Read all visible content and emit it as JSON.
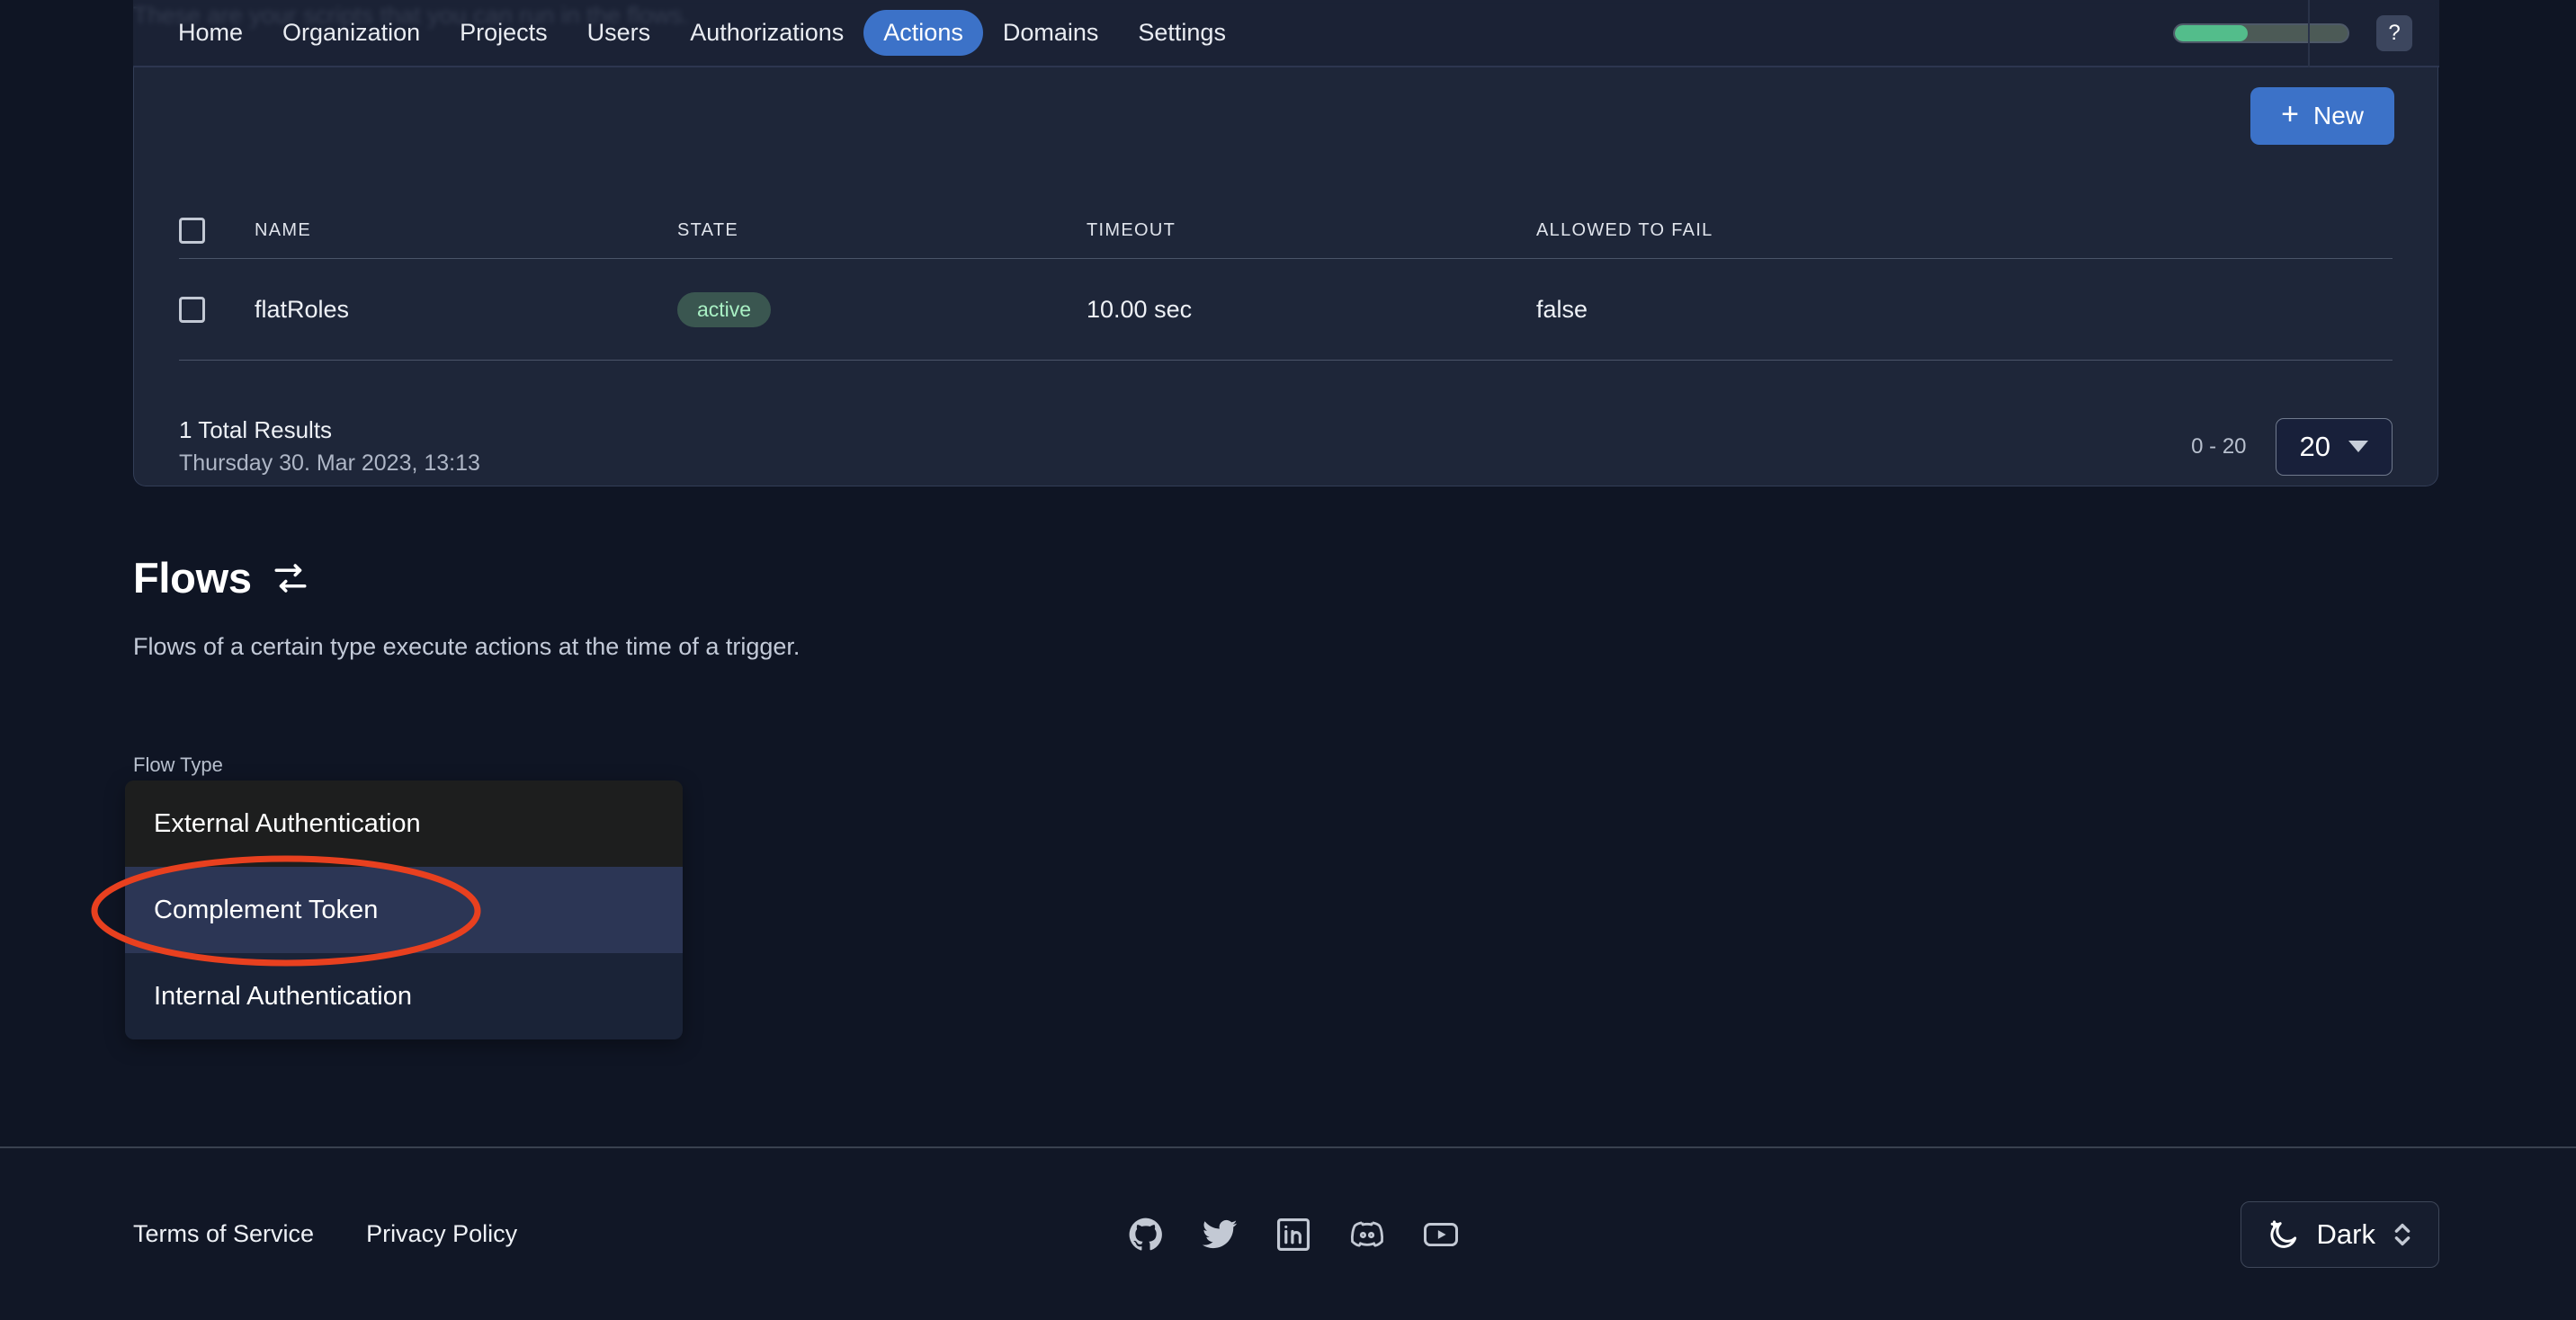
{
  "page": {
    "scrolled_under_text": "These are your scripts that you can run in the flows."
  },
  "nav": {
    "items": [
      {
        "label": "Home",
        "active": false
      },
      {
        "label": "Organization",
        "active": false
      },
      {
        "label": "Projects",
        "active": false
      },
      {
        "label": "Users",
        "active": false
      },
      {
        "label": "Authorizations",
        "active": false
      },
      {
        "label": "Actions",
        "active": true
      },
      {
        "label": "Domains",
        "active": false
      },
      {
        "label": "Settings",
        "active": false
      }
    ],
    "progress_percent": 42,
    "help_label": "?",
    "accent_color": "#3c72c8",
    "progress_color": "#53bd8b"
  },
  "actions_card": {
    "new_button_label": "New",
    "new_button_icon": "plus-icon",
    "table": {
      "columns": [
        "NAME",
        "STATE",
        "TIMEOUT",
        "ALLOWED TO FAIL"
      ],
      "rows": [
        {
          "name": "flatRoles",
          "state": "active",
          "timeout": "10.00 sec",
          "allowed_to_fail": "false"
        }
      ]
    },
    "footer": {
      "total_results": "1 Total Results",
      "timestamp": "Thursday 30. Mar 2023, 13:13",
      "range": "0 - 20",
      "page_size": "20"
    }
  },
  "flows": {
    "title": "Flows",
    "title_icon": "swap-arrows-icon",
    "description": "Flows of a certain type execute actions at the time of a trigger.",
    "flow_type_label": "Flow Type",
    "options": [
      {
        "label": "External Authentication",
        "state": "hover"
      },
      {
        "label": "Complement Token",
        "state": "selected"
      },
      {
        "label": "Internal Authentication",
        "state": "normal"
      }
    ],
    "annotation": {
      "shape": "ellipse",
      "color": "#e8401f",
      "targets": "Complement Token"
    }
  },
  "footer": {
    "links": [
      "Terms of Service",
      "Privacy Policy"
    ],
    "socials": [
      "github-icon",
      "twitter-icon",
      "linkedin-icon",
      "discord-icon",
      "youtube-icon"
    ],
    "theme": {
      "label": "Dark",
      "icon": "moon-icon"
    }
  }
}
